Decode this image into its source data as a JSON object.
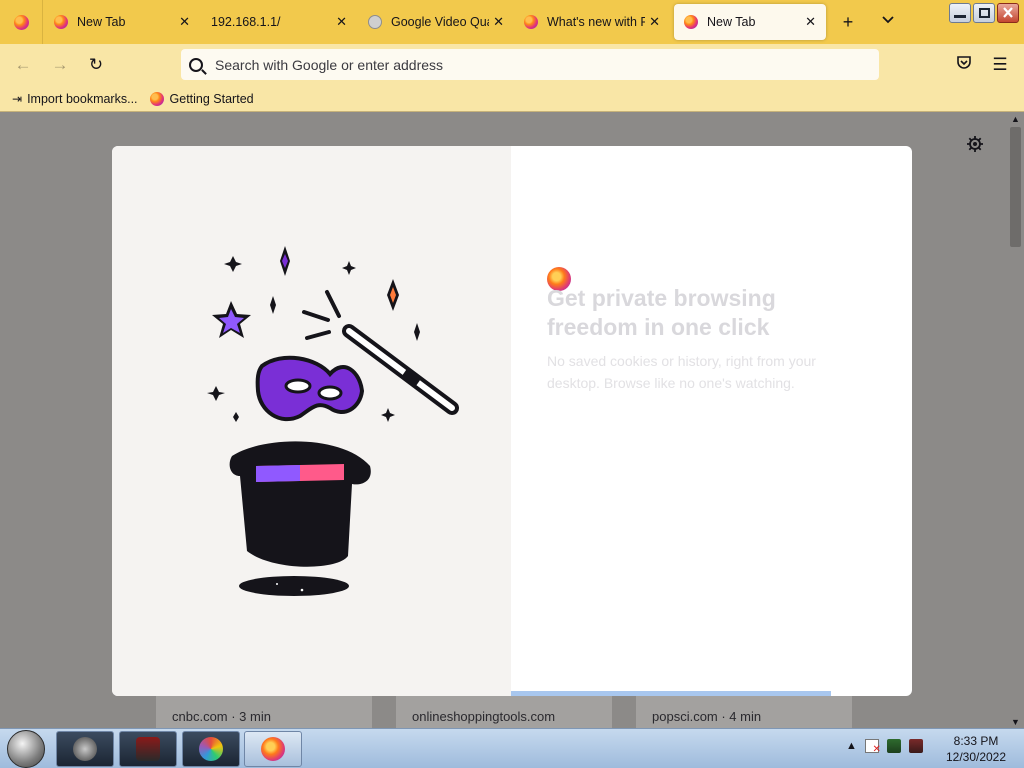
{
  "tabs": [
    {
      "title": "New Tab",
      "favicon": "firefox-icon"
    },
    {
      "title": "192.168.1.1/",
      "favicon": "none"
    },
    {
      "title": "Google Video Qual",
      "favicon": "compass-icon"
    },
    {
      "title": "What's new with Fi",
      "favicon": "firefox-icon"
    },
    {
      "title": "New Tab",
      "favicon": "firefox-icon",
      "active": true
    }
  ],
  "tab_controls": {
    "new_tab": "+",
    "list_all": "⌄",
    "close": "✕"
  },
  "navbar": {
    "back": "←",
    "forward": "→",
    "reload": "↻",
    "search_placeholder": "Search with Google or enter address",
    "pocket": "pocket-icon",
    "menu": "☰"
  },
  "bookmarks": [
    {
      "label": "Import bookmarks...",
      "icon": "import-icon"
    },
    {
      "label": "Getting Started",
      "icon": "firefox-icon"
    }
  ],
  "modal": {
    "heading": "Get private browsing freedom in one click",
    "body": "No saved cookies or history, right from your desktop. Browse like no one's watching.",
    "progress": 0.4
  },
  "top_stories": [
    {
      "source": "cnbc.com · 3 min"
    },
    {
      "source": "onlineshoppingtools.com"
    },
    {
      "source": "popsci.com · 4 min"
    }
  ],
  "taskbar": {
    "clock_time": "8:33 PM",
    "clock_date": "12/30/2022",
    "tray_show_hidden": "▲"
  },
  "colors": {
    "tab_strip": "#f2c94c",
    "toolbar": "#f9e6a6",
    "modal_left": "#f5f3f1",
    "mask_purple": "#7a2fd6"
  }
}
